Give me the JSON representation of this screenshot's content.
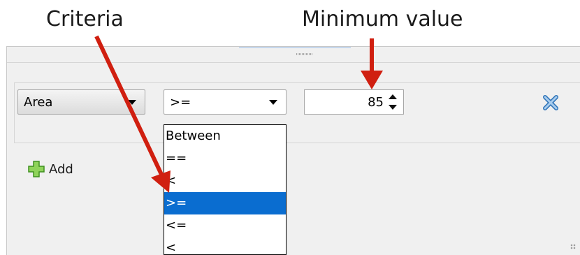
{
  "callouts": {
    "criteria": "Criteria",
    "minimum": "Minimum value"
  },
  "filter_row": {
    "field": {
      "value": "Area"
    },
    "operator": {
      "value": ">=",
      "options": [
        "Between",
        "==",
        "<",
        ">=",
        "<=",
        "<"
      ],
      "selected_index": 3
    },
    "minimum": {
      "value": "85"
    }
  },
  "add_button": {
    "label": "Add"
  },
  "colors": {
    "arrow": "#d01f10",
    "selection": "#0a6dd0",
    "add_icon": "#5cb82e",
    "remove_icon": "#3c86c8"
  },
  "icons": [
    "remove-icon",
    "add-plus-icon",
    "chevron-down-icon",
    "spin-up-icon",
    "spin-down-icon"
  ]
}
